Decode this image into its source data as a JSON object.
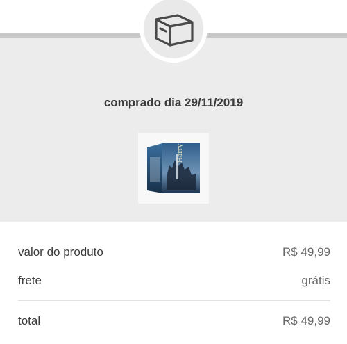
{
  "order": {
    "purchase_date": "comprado dia 29/11/2019",
    "icon": "box-icon",
    "product_image": "harry-potter-box-set-thumbnail"
  },
  "summary": {
    "product_value_label": "valor do produto",
    "product_value": "R$ 49,99",
    "shipping_label": "frete",
    "shipping_value": "grátis",
    "total_label": "total",
    "total_value": "R$ 49,99"
  },
  "colors": {
    "panel": "#ececec",
    "rule": "#c8c8c8",
    "text": "#333333",
    "muted": "#6a6a6a"
  }
}
